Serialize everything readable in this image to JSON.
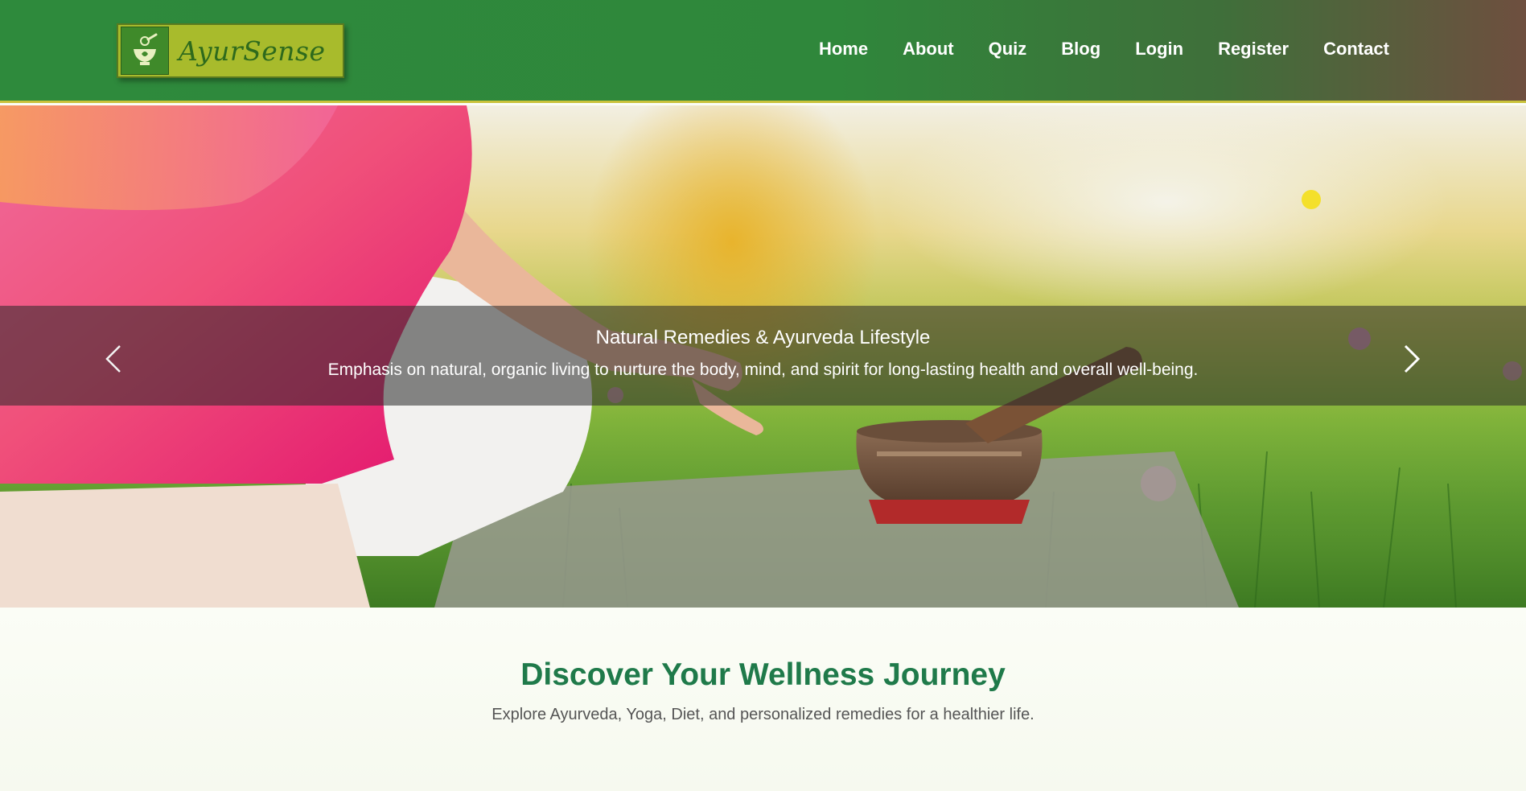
{
  "brand": {
    "name": "AyurSense",
    "logo_icon": "mortar-pestle-icon"
  },
  "nav": {
    "items": [
      {
        "label": "Home"
      },
      {
        "label": "About"
      },
      {
        "label": "Quiz"
      },
      {
        "label": "Blog"
      },
      {
        "label": "Login"
      },
      {
        "label": "Register"
      },
      {
        "label": "Contact"
      }
    ]
  },
  "hero": {
    "title": "Natural Remedies & Ayurveda Lifestyle",
    "subtitle": "Emphasis on natural, organic living to nurture the body, mind, and spirit for long-lasting health and overall well-being.",
    "prev_icon": "chevron-left-icon",
    "next_icon": "chevron-right-icon"
  },
  "wellness": {
    "title": "Discover Your Wellness Journey",
    "subtitle": "Explore Ayurveda, Yoga, Diet, and personalized remedies for a healthier life."
  },
  "colors": {
    "nav_green": "#2e8a3c",
    "nav_brown": "#6e4f3f",
    "nav_border": "#c9c23a",
    "logo_bg": "#a8bb2c",
    "heading_green": "#1f7a4a"
  }
}
